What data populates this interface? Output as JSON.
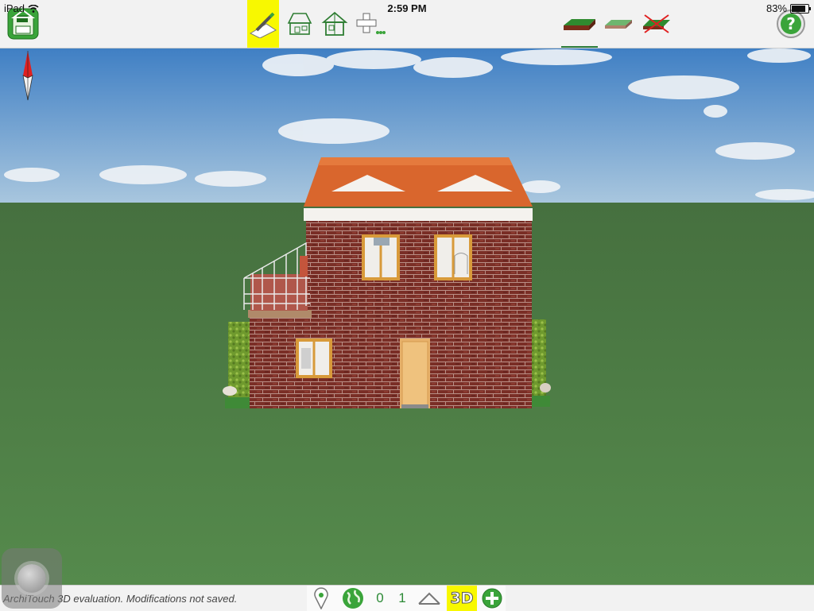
{
  "status_bar": {
    "carrier": "iPad",
    "time": "2:59 PM",
    "battery_text": "83%",
    "battery_level": 0.83
  },
  "toolbar": {
    "tools": [
      {
        "name": "save-file",
        "icon": "floppy-disk-icon"
      },
      {
        "name": "draw-plan",
        "icon": "pencil-plan-icon",
        "selected": true
      },
      {
        "name": "view-2d-house",
        "icon": "house-plan-icon"
      },
      {
        "name": "view-3d-house",
        "icon": "house-3d-icon"
      },
      {
        "name": "add-object",
        "icon": "plus-icon"
      },
      {
        "name": "ground-full",
        "icon": "ground-layer-icon",
        "selected": true
      },
      {
        "name": "ground-flat",
        "icon": "ground-flat-icon"
      },
      {
        "name": "ground-none",
        "icon": "ground-off-icon"
      },
      {
        "name": "help",
        "icon": "question-mark-icon"
      }
    ]
  },
  "bottom_bar": {
    "evaluation_notice": "ArchiTouch 3D evaluation. Modifications not saved.",
    "level_0": "0",
    "level_1": "1",
    "view_3d_label": "3D"
  },
  "colors": {
    "toolbar_bg": "#f2f2f2",
    "selected_highlight": "#f8f800",
    "grass": "#4f7d47",
    "sky": "#4a86c7",
    "brick": "#7a2e26",
    "roof": "#d9662d",
    "accent_green": "#2c8a36"
  }
}
